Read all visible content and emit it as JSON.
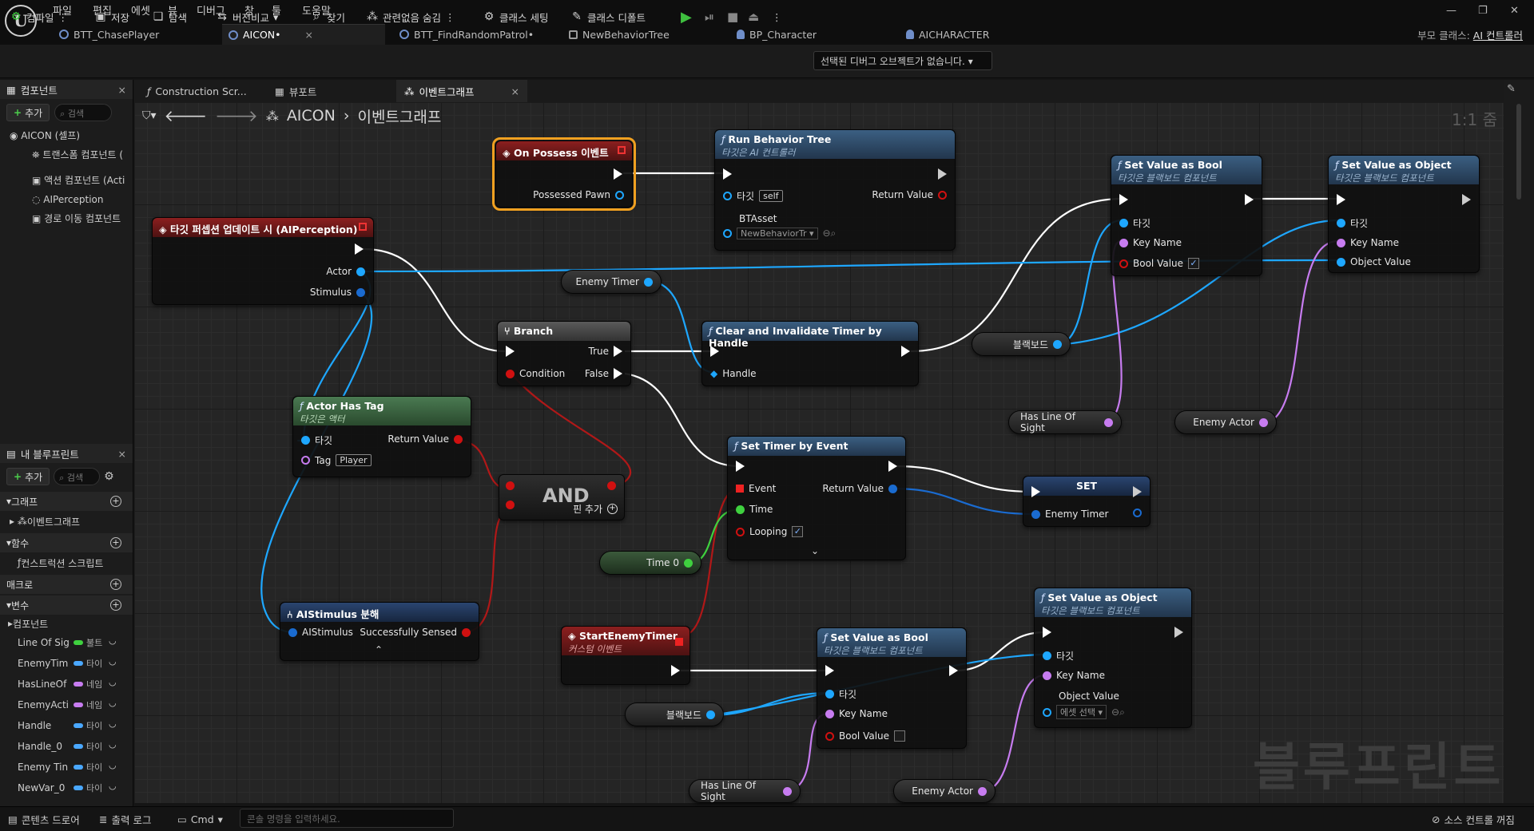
{
  "menu": [
    "파일",
    "편집",
    "에셋",
    "뷰",
    "디버그",
    "창",
    "툴",
    "도움말"
  ],
  "logo": "U",
  "tabs": [
    {
      "label": "BTT_ChasePlayer"
    },
    {
      "label": "AICON•",
      "close": "×"
    },
    {
      "label": "BTT_FindRandomPatrol•"
    },
    {
      "label": "NewBehaviorTree"
    },
    {
      "label": "BP_Character"
    },
    {
      "label": "AICHARACTER"
    }
  ],
  "parent_class": {
    "label": "부모 클래스:",
    "value": "AI 컨트롤러"
  },
  "toolbar": {
    "compile": "컴파일",
    "save": "저장",
    "browse": "탐색",
    "diff": "버전비교",
    "find": "찾기",
    "hide_unrelated": "관련없음 숨김",
    "class_settings": "클래스 세팅",
    "class_defaults": "클래스 디폴트",
    "debug_select": "선택된 디버그 오브젝트가 없습니다."
  },
  "components_panel": {
    "title": "컴포넌트",
    "add": "추가",
    "search": "검색",
    "items": [
      "AICON (셀프)",
      "트랜스폼 컴포넌트 (",
      "액션 컴포넌트 (Acti",
      "AIPerception",
      "경로 이동 컴포넌트"
    ]
  },
  "blueprint_panel": {
    "title": "내 블루프린트",
    "add": "추가",
    "search": "검색",
    "graph_section": "그래프",
    "event_graph": "이벤트그래프",
    "functions_section": "함수",
    "construction_script": "컨스트럭션 스크립트",
    "macros_section": "매크로",
    "variables_section": "변수",
    "components_sub": "컴포넌트",
    "variables": [
      {
        "name": "Line Of Sig",
        "type": "불트",
        "color": "#3fd13f"
      },
      {
        "name": "EnemyTim",
        "type": "타이",
        "color": "#4aa8ff"
      },
      {
        "name": "HasLineOf",
        "type": "네임",
        "color": "#c77cf0"
      },
      {
        "name": "EnemyActi",
        "type": "네임",
        "color": "#c77cf0"
      },
      {
        "name": "Handle",
        "type": "타이",
        "color": "#4aa8ff"
      },
      {
        "name": "Handle_0",
        "type": "타이",
        "color": "#4aa8ff"
      },
      {
        "name": "Enemy Tin",
        "type": "타이",
        "color": "#4aa8ff"
      },
      {
        "name": "NewVar_0",
        "type": "타이",
        "color": "#4aa8ff"
      }
    ]
  },
  "graph_tabs": [
    "Construction Scr...",
    "뷰포트",
    "이벤트그래프"
  ],
  "breadcrumb": {
    "root": "AICON",
    "current": "이벤트그래프"
  },
  "zoom": "1:1 줌",
  "watermark": "블루프린트",
  "nodes": {
    "on_possess": {
      "title": "On Possess 이벤트",
      "pawn": "Possessed Pawn"
    },
    "run_bt": {
      "title": "Run Behavior Tree",
      "sub": "타깃은 AI 컨트롤러",
      "target": "타깃",
      "self": "self",
      "return": "Return Value",
      "asset": "BTAsset",
      "asset_value": "NewBehaviorTr"
    },
    "perception": {
      "title": "타깃 퍼셉션 업데이트 시 (AIPerception)",
      "actor": "Actor",
      "stimulus": "Stimulus"
    },
    "enemy_timer_var": "Enemy Timer",
    "branch": {
      "title": "Branch",
      "cond": "Condition",
      "t": "True",
      "f": "False"
    },
    "clear_timer": {
      "title": "Clear and Invalidate Timer by Handle",
      "handle": "Handle"
    },
    "blackboard1": "블랙보드",
    "set_bool_1": {
      "title": "Set Value as Bool",
      "sub": "타깃은 블랙보드 컴포넌트",
      "target": "타깃",
      "key": "Key Name",
      "val": "Bool Value"
    },
    "set_obj_1": {
      "title": "Set Value as Object",
      "sub": "타깃은 블랙보드 컴포넌트",
      "target": "타깃",
      "key": "Key Name",
      "val": "Object Value"
    },
    "has_los_1": "Has Line Of Sight",
    "enemy_actor_1": "Enemy Actor",
    "actor_has_tag": {
      "title": "Actor Has Tag",
      "sub": "타깃은 액터",
      "target": "타깃",
      "ret": "Return Value",
      "tag": "Tag",
      "tag_value": "Player"
    },
    "and": {
      "title": "AND",
      "add": "핀 추가"
    },
    "set_timer": {
      "title": "Set Timer by Event",
      "event": "Event",
      "ret": "Return Value",
      "time": "Time",
      "looping": "Looping"
    },
    "set": {
      "title": "SET",
      "var": "Enemy Timer"
    },
    "time0": "Time 0",
    "ai_stim": {
      "title": "AIStimulus 분해",
      "stim": "AIStimulus",
      "sensed": "Successfully Sensed"
    },
    "start_timer": {
      "title": "StartEnemyTimer",
      "sub": "커스텀 이벤트"
    },
    "blackboard2": "블랙보드",
    "set_bool_2": {
      "title": "Set Value as Bool",
      "sub": "타깃은 블랙보드 컴포넌트",
      "target": "타깃",
      "key": "Key Name",
      "val": "Bool Value"
    },
    "set_obj_2": {
      "title": "Set Value as Object",
      "sub": "타깃은 블랙보드 컴포넌트",
      "target": "타깃",
      "key": "Key Name",
      "val": "Object Value",
      "asset": "에셋 선택"
    },
    "has_los_2": "Has Line Of Sight",
    "enemy_actor_2": "Enemy Actor"
  },
  "status": {
    "content_drawer": "콘텐츠 드로어",
    "output_log": "출력 로그",
    "cmd": "Cmd",
    "cmd_placeholder": "콘솔 명령을 입력하세요.",
    "source_control": "소스 컨트롤 꺼짐"
  },
  "colors": {
    "exec": "#ffffff",
    "object": "#1ea7ff",
    "bool": "#d01010",
    "name": "#c77cf0",
    "float": "#3fd13f",
    "struct": "#1a6bd0",
    "select": "#f0a020"
  }
}
